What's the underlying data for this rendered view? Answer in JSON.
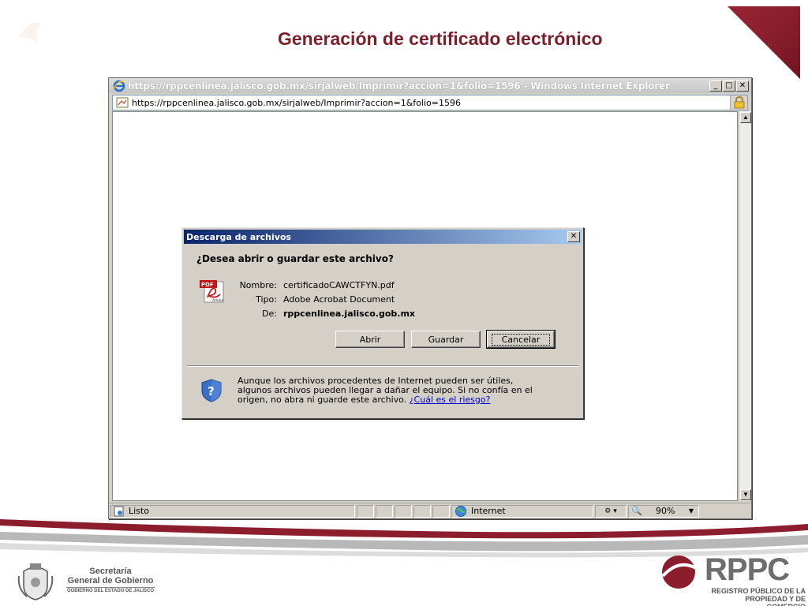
{
  "slide": {
    "title": "Generación de certificado electrónico"
  },
  "browser": {
    "window_title": "https://rppcenlinea.jalisco.gob.mx/sirjalweb/Imprimir?accion=1&folio=1596 - Windows Internet Explorer",
    "address": "https://rppcenlinea.jalisco.gob.mx/sirjalweb/Imprimir?accion=1&folio=1596",
    "status": {
      "text": "Listo",
      "zone": "Internet",
      "zoom": "90%"
    }
  },
  "dialog": {
    "title": "Descarga de archivos",
    "question": "¿Desea abrir o guardar este archivo?",
    "fields": {
      "name_label": "Nombre:",
      "name_value": "certificadoCAWCTFYN.pdf",
      "type_label": "Tipo:",
      "type_value": "Adobe Acrobat Document",
      "from_label": "De:",
      "from_value": "rppcenlinea.jalisco.gob.mx"
    },
    "buttons": {
      "open": "Abrir",
      "save": "Guardar",
      "cancel": "Cancelar"
    },
    "warning": "Aunque los archivos procedentes de Internet pueden ser útiles, algunos archivos pueden llegar a dañar el equipo. Si no confía en el origen, no abra ni guarde este archivo.",
    "risk_link": "¿Cuál es el riesgo?",
    "pdf_icon_label": "PDF",
    "pdf_icon_sub": "Adobe"
  },
  "footer": {
    "gov_line1": "Secretaría",
    "gov_line2": "General de Gobierno",
    "gov_line3": "GOBIERNO DEL ESTADO DE JALISCO",
    "rppc_brand": "RPPC",
    "rppc_sub1": "REGISTRO PÚBLICO DE LA",
    "rppc_sub2": "PROPIEDAD Y DE COMERCIO"
  },
  "colors": {
    "title": "#7a1f2b",
    "accent": "#8b1d2c",
    "dialog_titlebar": "#0a246a"
  }
}
